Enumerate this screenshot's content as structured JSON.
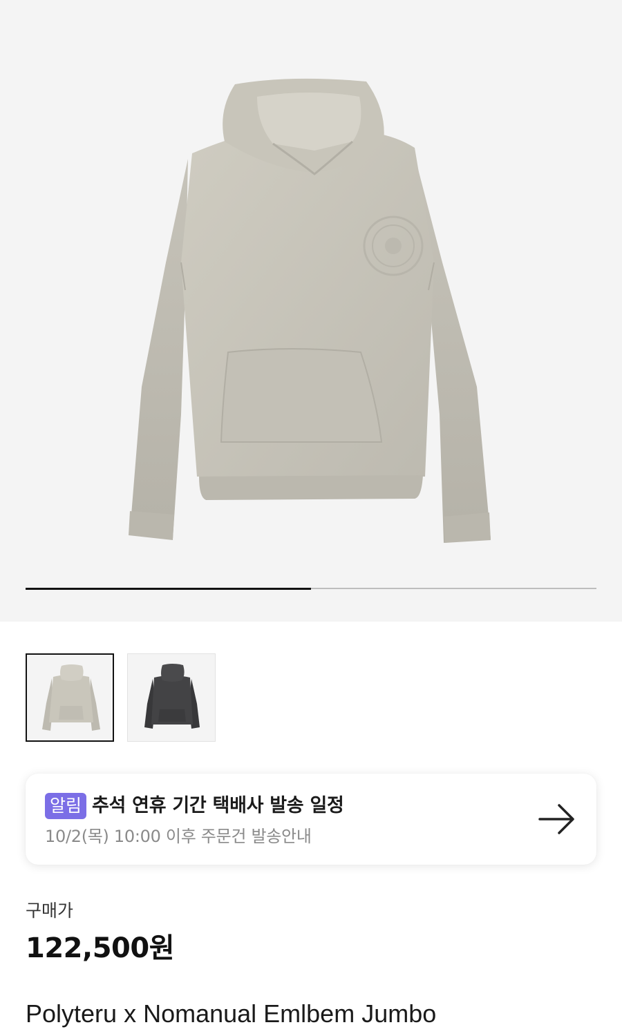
{
  "gallery": {
    "current_index": 1,
    "total_images": 2,
    "progress_fraction": 0.5
  },
  "thumbnails": [
    {
      "name": "beige-hoodie",
      "color": "#c9c6bb",
      "selected": true
    },
    {
      "name": "charcoal-hoodie",
      "color": "#3f3f40",
      "selected": false
    }
  ],
  "notice": {
    "badge": "알림",
    "title": "추석 연휴 기간 택배사 발송 일정",
    "subtitle": "10/2(목) 10:00 이후 주문건 발송안내",
    "arrow_icon": "arrow-right-icon",
    "badge_color": "#7b6ee6"
  },
  "price": {
    "label": "구매가",
    "value": "122,500원"
  },
  "product": {
    "name": "Polyteru x Nomanual Emlbem Jumbo"
  }
}
